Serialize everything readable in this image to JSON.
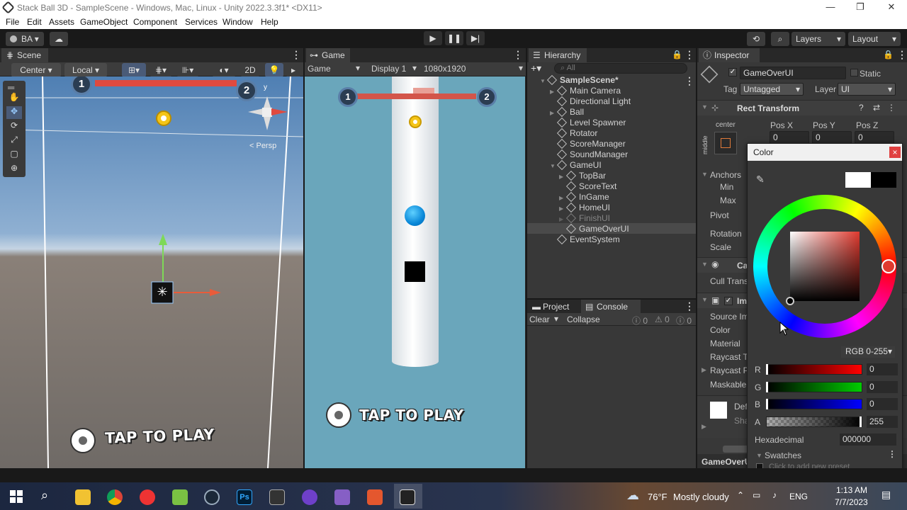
{
  "window": {
    "title": "Stack Ball 3D - SampleScene - Windows, Mac, Linux - Unity 2022.3.3f1* <DX11>",
    "minimize": "—",
    "maximize": "❐",
    "close": "✕"
  },
  "menu": [
    "File",
    "Edit",
    "Assets",
    "GameObject",
    "Component",
    "Services",
    "Window",
    "Help"
  ],
  "toolbar": {
    "account": "BA",
    "layers": "Layers",
    "layout": "Layout"
  },
  "scene_panel": {
    "tab": "Scene",
    "pivot": "Center",
    "space": "Local",
    "mode_2d": "2D",
    "persp": "< Persp",
    "gizmo_y": "y",
    "marker_1": "1",
    "marker_2": "2",
    "tap_to_play": "TAP TO PLAY"
  },
  "game_panel": {
    "tab": "Game",
    "view_mode": "Game",
    "display": "Display 1",
    "resolution": "1080x1920",
    "marker_1": "1",
    "marker_2": "2",
    "tap_to_play": "TAP TO PLAY"
  },
  "hierarchy": {
    "tab": "Hierarchy",
    "search_placeholder": "All",
    "items": [
      {
        "label": "SampleScene*",
        "indent": 0,
        "arrow": "▼"
      },
      {
        "label": "Main Camera",
        "indent": 1,
        "arrow": "▶"
      },
      {
        "label": "Directional Light",
        "indent": 1,
        "arrow": ""
      },
      {
        "label": "Ball",
        "indent": 1,
        "arrow": "▶"
      },
      {
        "label": "Level Spawner",
        "indent": 1,
        "arrow": ""
      },
      {
        "label": "Rotator",
        "indent": 1,
        "arrow": ""
      },
      {
        "label": "ScoreManager",
        "indent": 1,
        "arrow": ""
      },
      {
        "label": "SoundManager",
        "indent": 1,
        "arrow": ""
      },
      {
        "label": "GameUI",
        "indent": 1,
        "arrow": "▼"
      },
      {
        "label": "TopBar",
        "indent": 2,
        "arrow": "▶"
      },
      {
        "label": "ScoreText",
        "indent": 2,
        "arrow": ""
      },
      {
        "label": "InGame",
        "indent": 2,
        "arrow": "▶"
      },
      {
        "label": "HomeUI",
        "indent": 2,
        "arrow": "▶"
      },
      {
        "label": "FinishUI",
        "indent": 2,
        "arrow": "▶"
      },
      {
        "label": "GameOverUI",
        "indent": 2,
        "arrow": ""
      },
      {
        "label": "EventSystem",
        "indent": 1,
        "arrow": ""
      }
    ]
  },
  "project_panel": {
    "tab_project": "Project",
    "tab_console": "Console",
    "clear": "Clear",
    "collapse": "Collapse",
    "count_log": "0",
    "count_warn": "0",
    "count_err": "0"
  },
  "inspector": {
    "tab": "Inspector",
    "object_name": "GameOverUI",
    "static": "Static",
    "tag_label": "Tag",
    "tag_value": "Untagged",
    "layer_label": "Layer",
    "layer_value": "UI",
    "rect_transform": "Rect Transform",
    "anchor_center": "center",
    "anchor_middle": "middle",
    "pos_x": "Pos X",
    "pos_y": "Pos Y",
    "pos_z": "Pos Z",
    "pos_x_val": "0",
    "pos_y_val": "0",
    "pos_z_val": "0",
    "anchors": "Anchors",
    "min": "Min",
    "max": "Max",
    "pivot": "Pivot",
    "rotation": "Rotation",
    "scale": "Scale",
    "canvas_renderer": "Ca",
    "cull": "Cull Transp",
    "image": "Ima",
    "source_image": "Source Im",
    "color": "Color",
    "material": "Material",
    "raycast_target": "Raycast T",
    "raycast_padding": "Raycast P",
    "maskable": "Maskable",
    "default_material": "Def",
    "shader": "Sha",
    "footer": "GameOverU"
  },
  "color_picker": {
    "title": "Color",
    "close": "×",
    "mode": "RGB 0-255",
    "r_label": "R",
    "r_value": "0",
    "g_label": "G",
    "g_value": "0",
    "b_label": "B",
    "b_value": "0",
    "a_label": "A",
    "a_value": "255",
    "hex_label": "Hexadecimal",
    "hex_value": "000000",
    "swatches": "Swatches",
    "add_preset": "Click to add new preset"
  },
  "taskbar": {
    "temperature": "76°F",
    "weather": "Mostly cloudy",
    "language": "ENG",
    "time": "1:13 AM",
    "date": "7/7/2023"
  },
  "colors": {
    "panel_bg": "#383838",
    "game_bg": "#6aa6bb",
    "selection": "#4a4a4a",
    "picker_red": "#e8392b"
  }
}
